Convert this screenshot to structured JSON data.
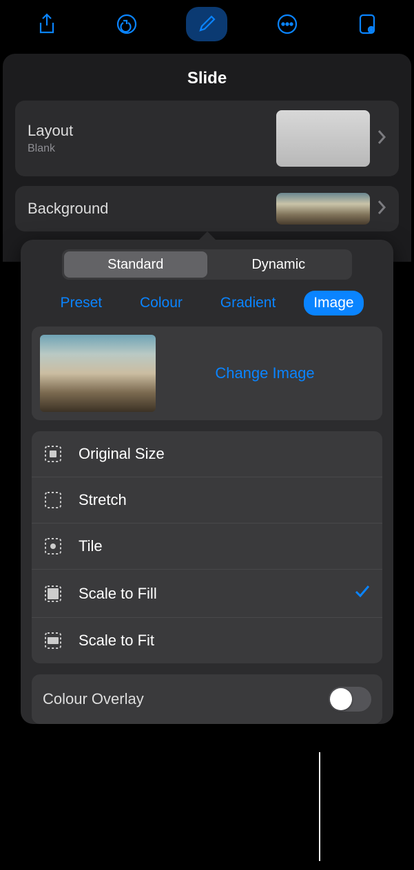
{
  "panel_title": "Slide",
  "layout": {
    "title": "Layout",
    "subtitle": "Blank"
  },
  "background": {
    "title": "Background"
  },
  "segments": {
    "standard": "Standard",
    "dynamic": "Dynamic"
  },
  "fill_tabs": {
    "preset": "Preset",
    "colour": "Colour",
    "gradient": "Gradient",
    "image": "Image"
  },
  "change_image": "Change Image",
  "scale_options": {
    "original": "Original Size",
    "stretch": "Stretch",
    "tile": "Tile",
    "scale_fill": "Scale to Fill",
    "scale_fit": "Scale to Fit"
  },
  "selected_scale": "scale_fill",
  "colour_overlay": {
    "label": "Colour Overlay",
    "on": false
  }
}
